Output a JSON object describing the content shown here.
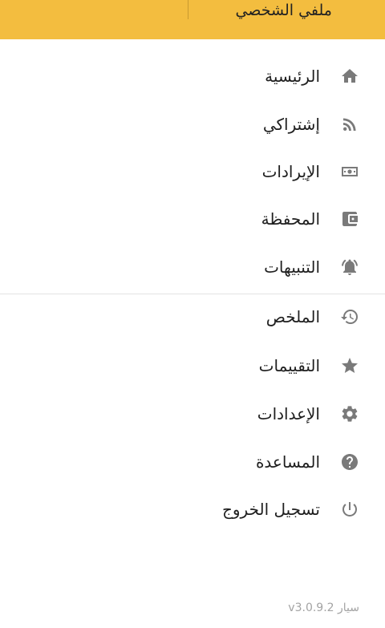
{
  "header": {
    "title": "ملفي الشخصي"
  },
  "menu": [
    {
      "label": "الرئيسية",
      "icon": "home-icon"
    },
    {
      "label": "إشتراكي",
      "icon": "rss-feed-icon"
    },
    {
      "label": "الإيرادات",
      "icon": "money-icon"
    },
    {
      "label": "المحفظة",
      "icon": "wallet-icon"
    },
    {
      "label": "التنبيهات",
      "icon": "bell-ringing-icon"
    },
    {
      "label": "الملخص",
      "icon": "history-icon"
    },
    {
      "label": "التقييمات",
      "icon": "star-icon"
    },
    {
      "label": "الإعدادات",
      "icon": "gear-icon"
    },
    {
      "label": "المساعدة",
      "icon": "help-circle-icon"
    },
    {
      "label": "تسجيل الخروج",
      "icon": "power-icon"
    }
  ],
  "footer": {
    "version": "سيار v3.0.9.2"
  },
  "colors": {
    "header_bg": "#f3bd3f",
    "icon": "#7a7a7a",
    "text": "#1f1f1f",
    "version_text": "#a3a3a3"
  }
}
